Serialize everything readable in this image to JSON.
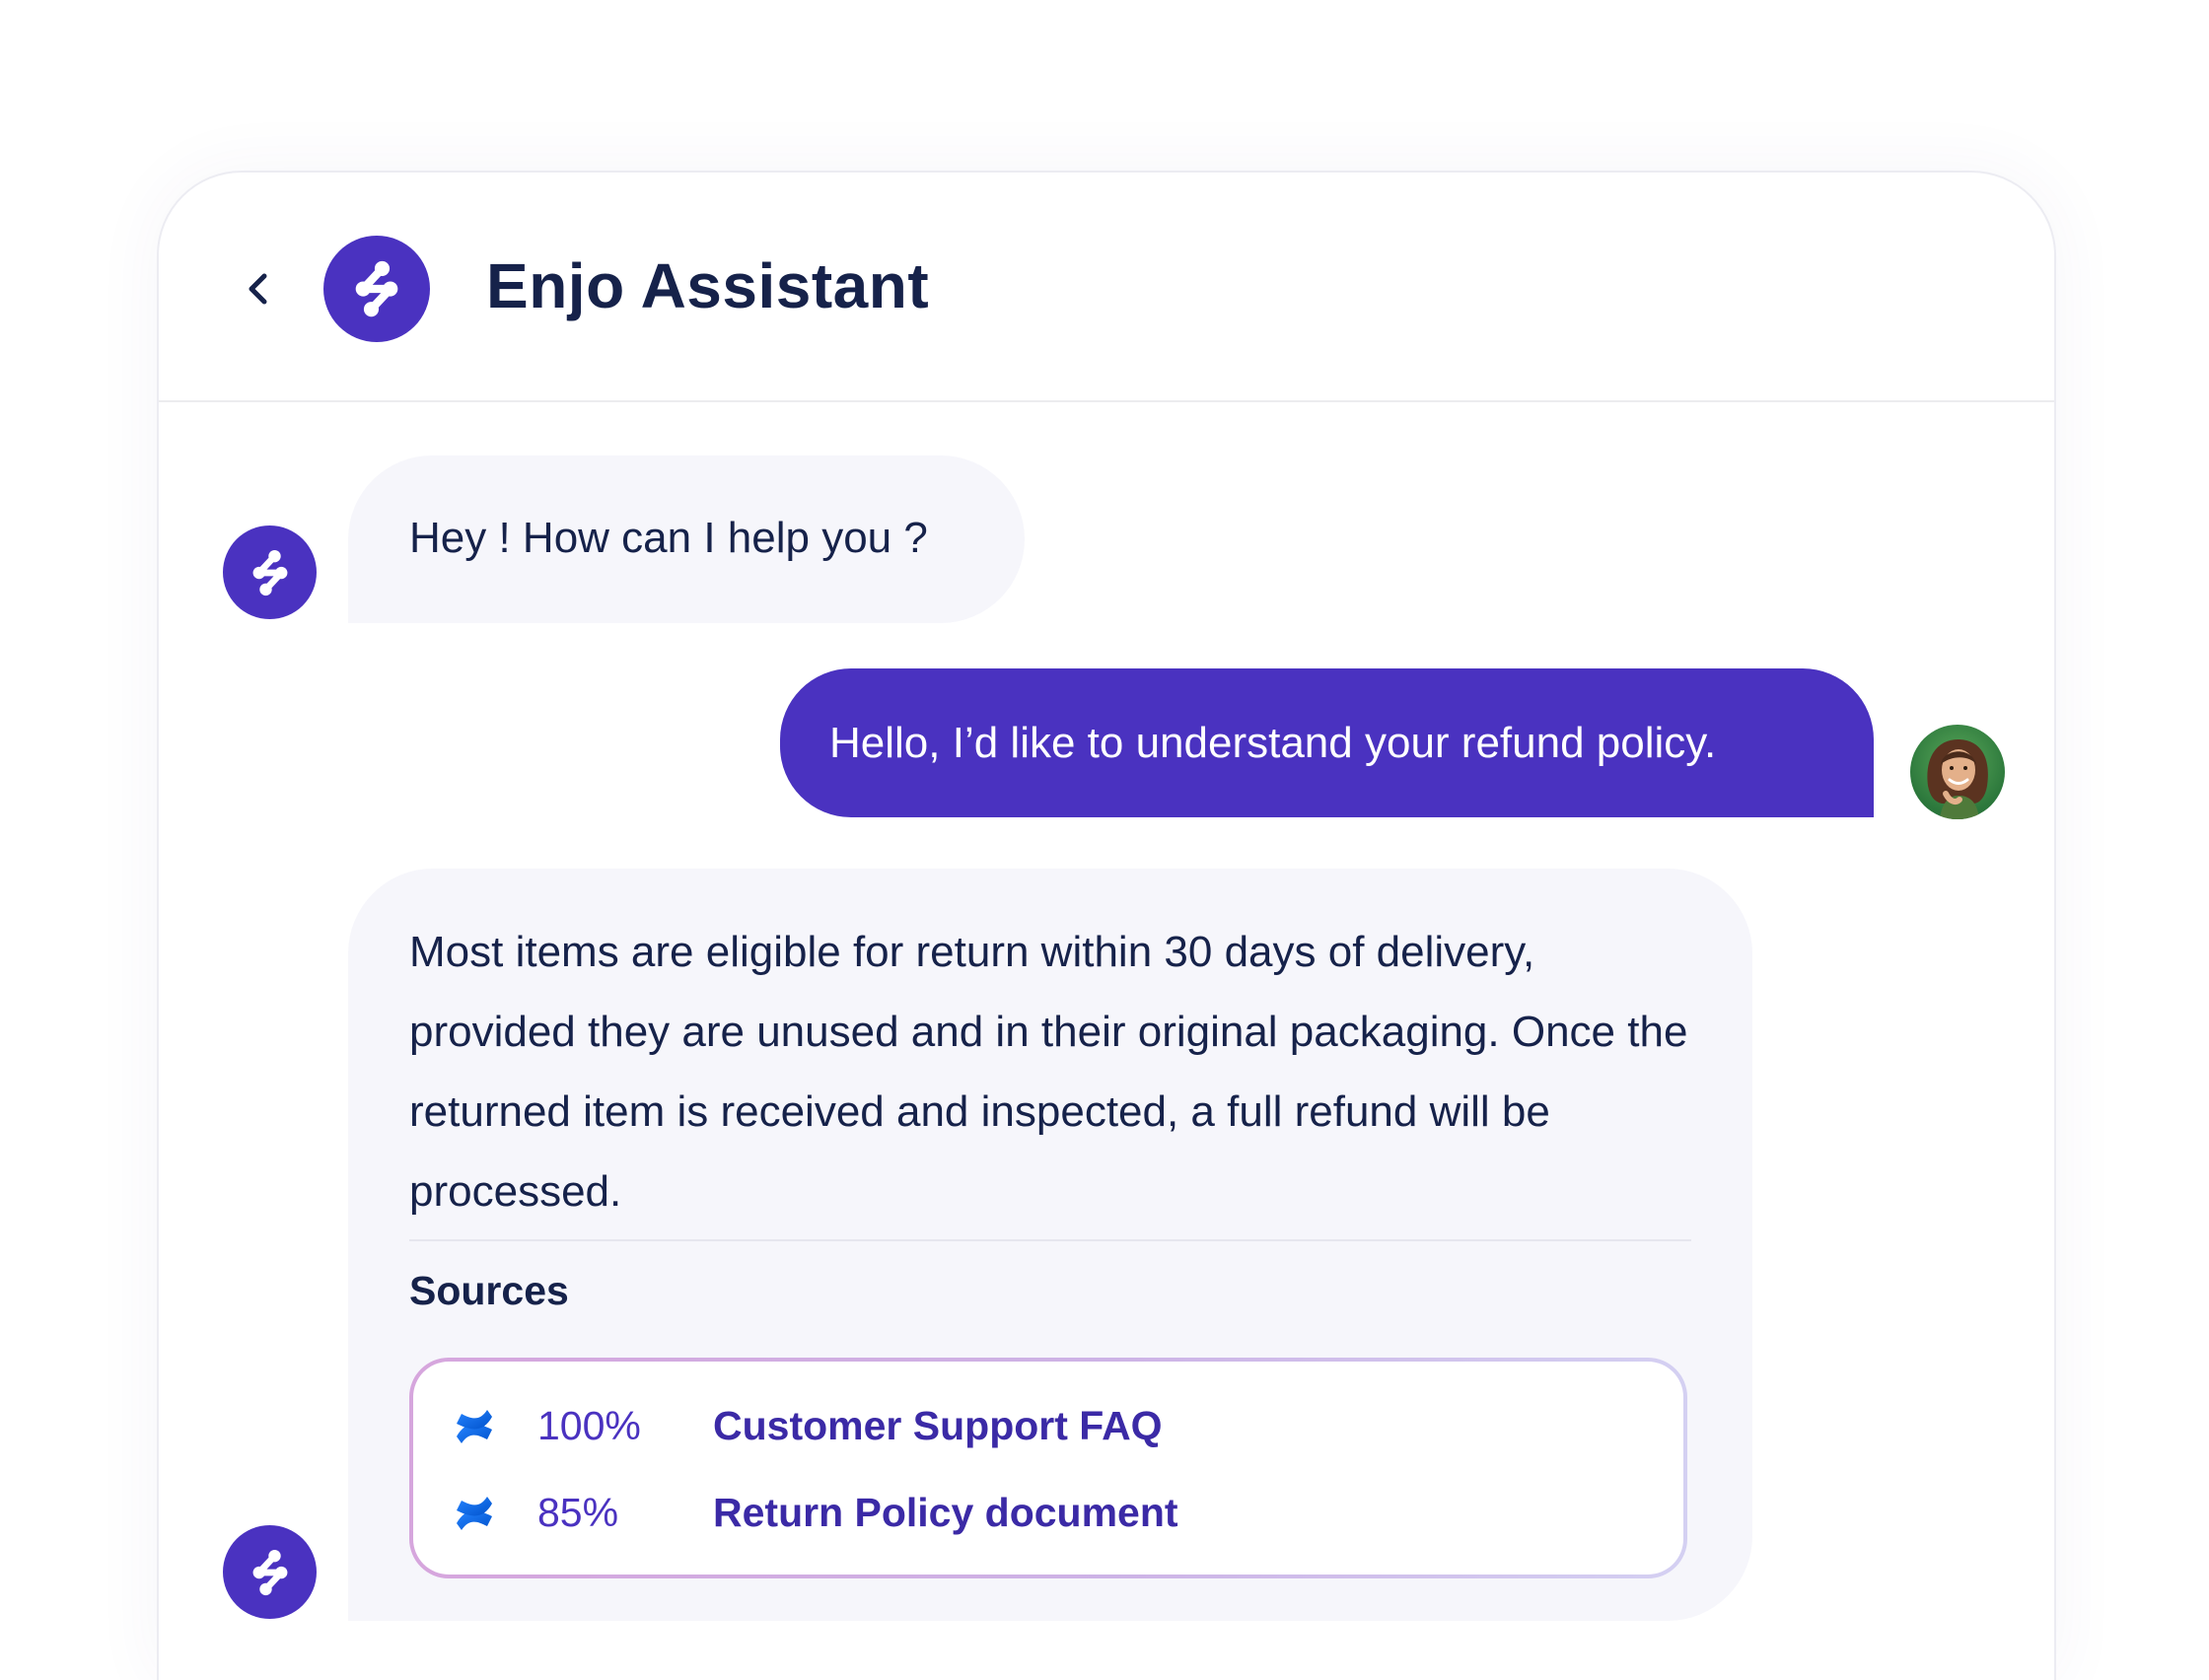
{
  "header": {
    "title": "Enjo Assistant",
    "back_icon": "chevron-left-icon",
    "logo_icon": "enjo-logo-icon"
  },
  "colors": {
    "brand": "#4a32c0",
    "bot_bubble": "#f6f6fb",
    "text": "#16224a",
    "source_border": "#d6a6dd"
  },
  "messages": [
    {
      "sender": "bot",
      "text": "Hey ! How can I help you ?"
    },
    {
      "sender": "user",
      "text": "Hello, I’d like to understand your refund policy."
    },
    {
      "sender": "bot",
      "text": "Most items are eligible for return within 30 days of delivery, provided they are unused and in their original packaging. Once the returned item is received and inspected, a full refund will be processed.",
      "sources_label": "Sources",
      "sources": [
        {
          "icon": "confluence-icon",
          "confidence": "100%",
          "name": "Customer Support FAQ"
        },
        {
          "icon": "confluence-icon",
          "confidence": "85%",
          "name": "Return Policy document"
        }
      ]
    }
  ]
}
